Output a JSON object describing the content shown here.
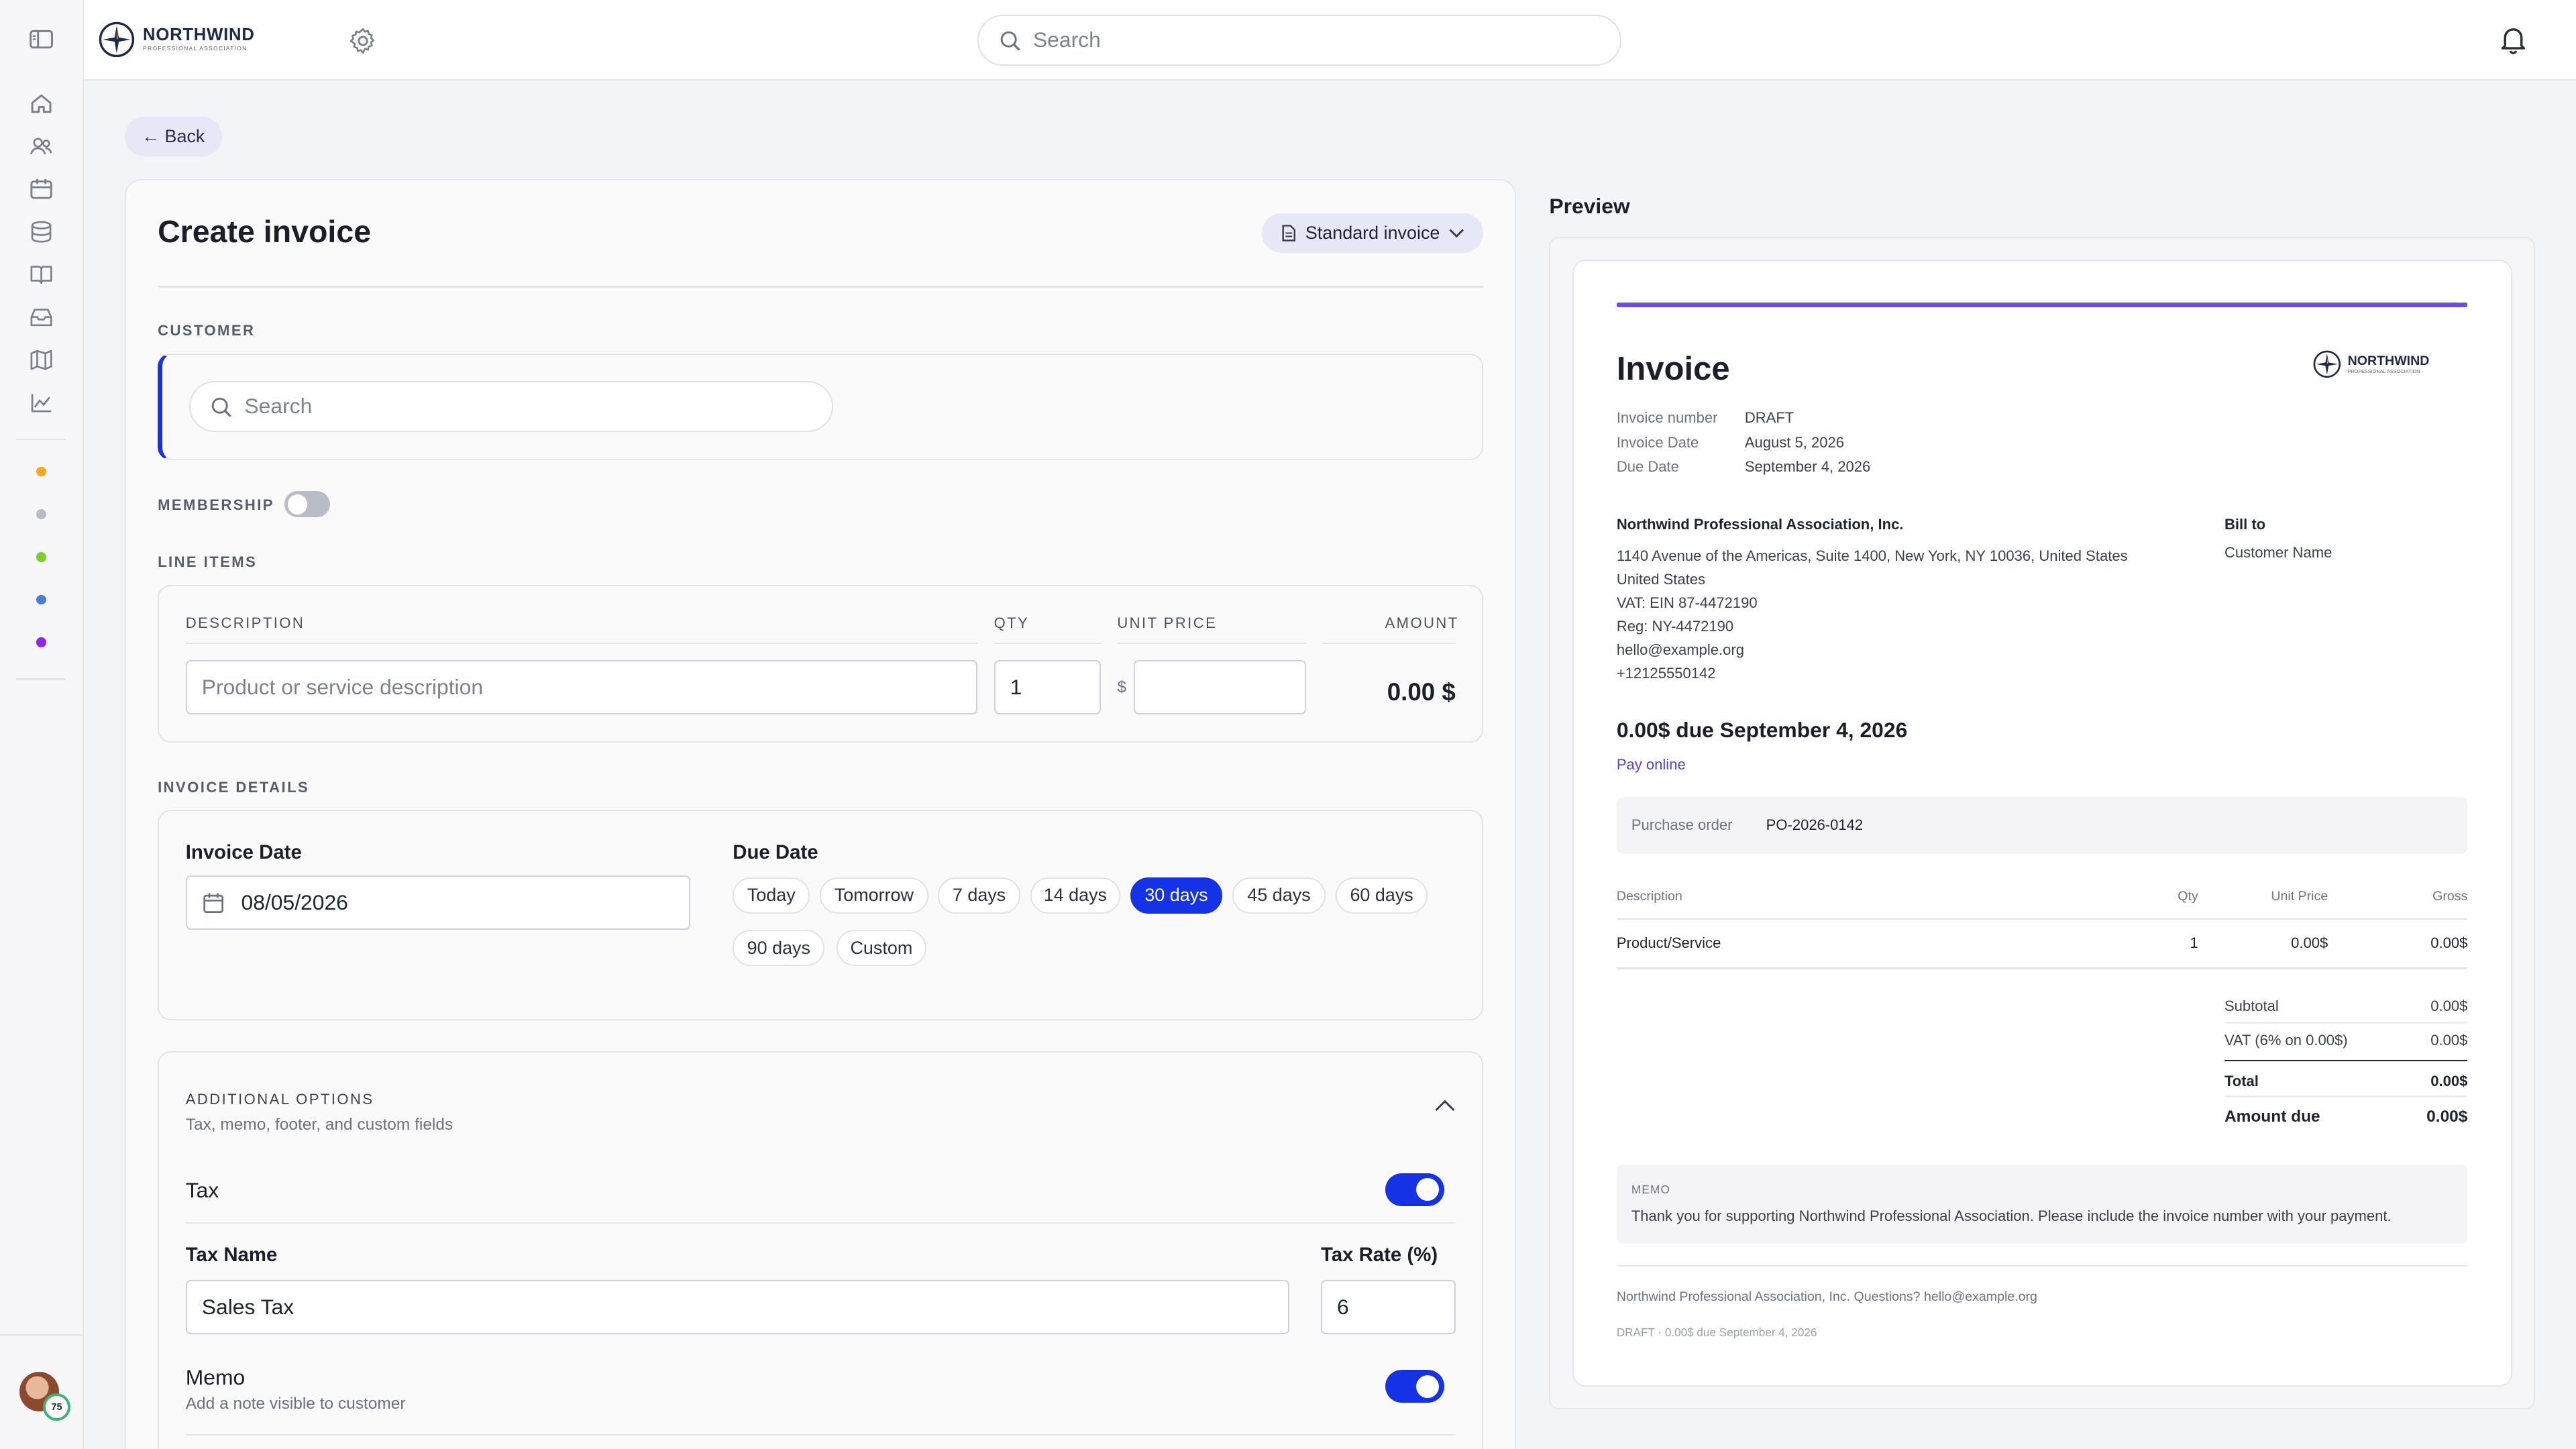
{
  "app": {
    "brand_name": "NORTHWIND",
    "brand_tagline": "PROFESSIONAL ASSOCIATION"
  },
  "topbar": {
    "search_placeholder": "Search"
  },
  "sidebar": {
    "items": [
      "sidebar-toggle-icon",
      "home-icon",
      "users-icon",
      "calendar-icon",
      "database-icon",
      "book-icon",
      "inbox-icon",
      "map-icon",
      "chart-icon"
    ],
    "dots": [
      "#f5a623",
      "#b8bcc6",
      "#7ccf2a",
      "#4a7fd8",
      "#8a2be2"
    ],
    "avatar_badge": "75"
  },
  "back": {
    "label": "Back"
  },
  "form": {
    "title": "Create invoice",
    "invoice_type": "Standard invoice",
    "customer": {
      "section_label": "CUSTOMER",
      "search_placeholder": "Search"
    },
    "membership_label": "MEMBERSHIP",
    "line_items": {
      "section_label": "LINE ITEMS",
      "columns": {
        "description": "DESCRIPTION",
        "qty": "QTY",
        "unit_price": "UNIT PRICE",
        "amount": "AMOUNT"
      },
      "description_placeholder": "Product or service description",
      "qty_value": "1",
      "currency_symbol": "$",
      "amount_value": "0.00 $"
    },
    "invoice_details": {
      "section_label": "INVOICE DETAILS",
      "invoice_date_label": "Invoice Date",
      "invoice_date_value": "08/05/2026",
      "due_date_label": "Due Date",
      "due_options": [
        "Today",
        "Tomorrow",
        "7 days",
        "14 days",
        "30 days",
        "45 days",
        "60 days",
        "90 days",
        "Custom"
      ],
      "due_selected": "30 days"
    },
    "additional": {
      "section_label": "ADDITIONAL OPTIONS",
      "subtitle": "Tax, memo, footer, and custom fields",
      "tax_label": "Tax",
      "tax_enabled": true,
      "tax_name_label": "Tax Name",
      "tax_name_value": "Sales Tax",
      "tax_rate_label": "Tax Rate (%)",
      "tax_rate_value": "6",
      "memo_label": "Memo",
      "memo_sub": "Add a note visible to customer",
      "memo_enabled": true
    }
  },
  "preview": {
    "heading": "Preview",
    "accent_color": "#6c4fe0",
    "title": "Invoice",
    "meta": [
      {
        "label": "Invoice number",
        "value": "DRAFT"
      },
      {
        "label": "Invoice Date",
        "value": "August 5, 2026"
      },
      {
        "label": "Due Date",
        "value": "September 4, 2026"
      }
    ],
    "from": {
      "name": "Northwind Professional Association, Inc.",
      "lines": [
        "1140 Avenue of the Americas, Suite 1400, New York, NY 10036, United States",
        "United States",
        "VAT: EIN 87-4472190",
        "Reg: NY-4472190",
        "hello@example.org",
        "+12125550142"
      ]
    },
    "bill_to": {
      "label": "Bill to",
      "name": "Customer Name"
    },
    "due_headline": "0.00$ due September 4, 2026",
    "pay_online": "Pay online",
    "po": {
      "label": "Purchase order",
      "value": "PO-2026-0142"
    },
    "table": {
      "headers": {
        "description": "Description",
        "qty": "Qty",
        "unit_price": "Unit Price",
        "gross": "Gross"
      },
      "row": {
        "description": "Product/Service",
        "qty": "1",
        "unit_price": "0.00$",
        "gross": "0.00$"
      }
    },
    "totals": [
      {
        "label": "Subtotal",
        "value": "0.00$"
      },
      {
        "label": "VAT (6% on 0.00$)",
        "value": "0.00$"
      },
      {
        "label": "Total",
        "value": "0.00$"
      },
      {
        "label": "Amount due",
        "value": "0.00$"
      }
    ],
    "memo_label": "MEMO",
    "memo_text": "Thank you for supporting Northwind Professional Association. Please include the invoice number with your payment.",
    "footer_line": "Northwind Professional Association, Inc. Questions? hello@example.org",
    "footer_sub": "DRAFT · 0.00$ due September 4, 2026"
  }
}
